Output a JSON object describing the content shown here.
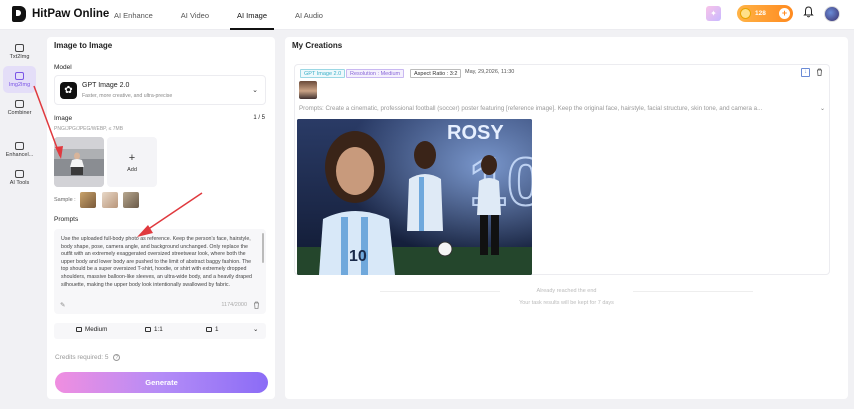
{
  "app": {
    "name": "HitPaw Online"
  },
  "nav": [
    "AI Enhance",
    "AI Video",
    "AI Image",
    "AI Audio"
  ],
  "header": {
    "credits": "128"
  },
  "sidebar": {
    "items": [
      {
        "label": "Txt2Img"
      },
      {
        "label": "Img2Img"
      },
      {
        "label": "Combiner"
      },
      {
        "label": "Enhancel..."
      },
      {
        "label": "AI Tools"
      }
    ]
  },
  "left": {
    "title": "Image to Image",
    "model_label": "Model",
    "model_name": "GPT Image 2.0",
    "model_desc": "Faster, more creative, and ultra-precise",
    "image_label": "Image",
    "image_count": "1 / 5",
    "image_hint": "PNG/JPG/JPEG/WEBP, ≤ 7MB",
    "add_label": "Add",
    "sample_label": "Sample :",
    "prompts_label": "Prompts",
    "prompt_text": "Use the uploaded full-body photo as reference. Keep the person's face, hairstyle, body shape, pose, camera angle, and background unchanged. Only replace the outfit with an extremely exaggerated oversized streetwear look, where both the upper body and lower body are pushed to the limit of abstract baggy fashion. The top should be a super oversized T-shirt, hoodie, or shirt with extremely dropped shoulders, massive balloon-like sleeves, an ultra-wide body, and a heavily draped silhouette, making the upper body look intentionally swallowed by fabric.",
    "char_count": "1174/2000",
    "options": {
      "quality": "Medium",
      "ratio": "1:1",
      "count": "1"
    },
    "credits_required": "Credits required: 5",
    "generate_label": "Generate"
  },
  "right": {
    "title": "My Creations",
    "card": {
      "model_tag": "GPT Image 2.0",
      "resolution_tag": "Resolution : Medium",
      "ratio_tag": "Aspect Ratio : 3:2",
      "date": "May, 29,2026, 11:30",
      "prompt": "Prompts: Create a cinematic, professional football (soccer) poster featuring [reference image]. Keep the original face, hairstyle, facial structure, skin tone, and camera a..."
    },
    "end_text": "Already reached the end",
    "keep_text": "Your task results will be kept for 7 days"
  },
  "poster": {
    "name": "ROSY",
    "number": "10"
  },
  "colors": {
    "accent": "#7b55e6",
    "orange": "#ff8a1f",
    "arrow": "#e0393e"
  }
}
